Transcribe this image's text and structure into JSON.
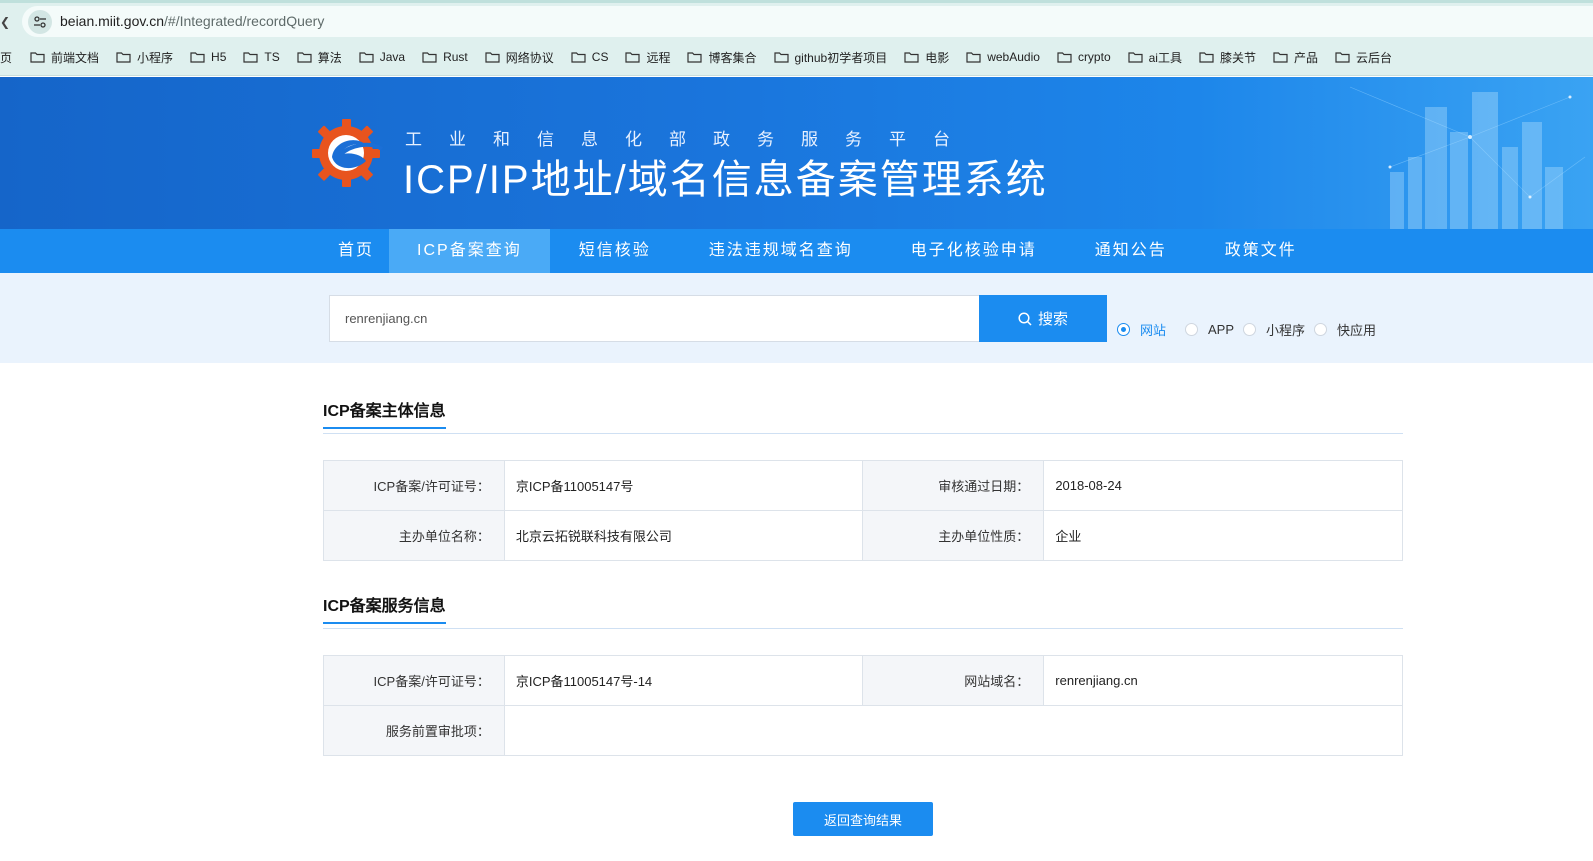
{
  "browser": {
    "left_edge_glyph": "•",
    "url_host": "beian.miit.gov.cn",
    "url_path": "/#/Integrated/recordQuery"
  },
  "bookmarks": {
    "first_partial": "页",
    "items": [
      "前端文档",
      "小程序",
      "H5",
      "TS",
      "算法",
      "Java",
      "Rust",
      "网络协议",
      "CS",
      "远程",
      "博客集合",
      "github初学者项目",
      "电影",
      "webAudio",
      "crypto",
      "ai工具",
      "膝关节",
      "产品",
      "云后台"
    ]
  },
  "banner": {
    "subtitle": "工业和信息化部政务服务平台",
    "title": "ICP/IP地址/域名信息备案管理系统"
  },
  "nav": {
    "items": [
      "首页",
      "ICP备案查询",
      "短信核验",
      "违法违规域名查询",
      "电子化核验申请",
      "通知公告",
      "政策文件"
    ],
    "active": "ICP备案查询"
  },
  "search": {
    "value": "renrenjiang.cn",
    "button_label": "搜索",
    "options": [
      "网站",
      "APP",
      "小程序",
      "快应用"
    ],
    "selected": "网站"
  },
  "subject_info": {
    "title": "ICP备案主体信息",
    "rows": [
      {
        "k1": "ICP备案/许可证号：",
        "v1": "京ICP备11005147号",
        "k2": "审核通过日期：",
        "v2": "2018-08-24"
      },
      {
        "k1": "主办单位名称：",
        "v1": "北京云拓锐联科技有限公司",
        "k2": "主办单位性质：",
        "v2": "企业"
      }
    ]
  },
  "service_info": {
    "title": "ICP备案服务信息",
    "row1": {
      "k1": "ICP备案/许可证号：",
      "v1": "京ICP备11005147号-14",
      "k2": "网站域名：",
      "v2": "renrenjiang.cn"
    },
    "row2": {
      "k": "服务前置审批项：",
      "v": ""
    }
  },
  "back_button": "返回查询结果",
  "colors": {
    "primary": "#1b8cf0",
    "banner": "#1565c9",
    "band": "#eaf3fd",
    "nav_active": "#4aaaf6"
  }
}
